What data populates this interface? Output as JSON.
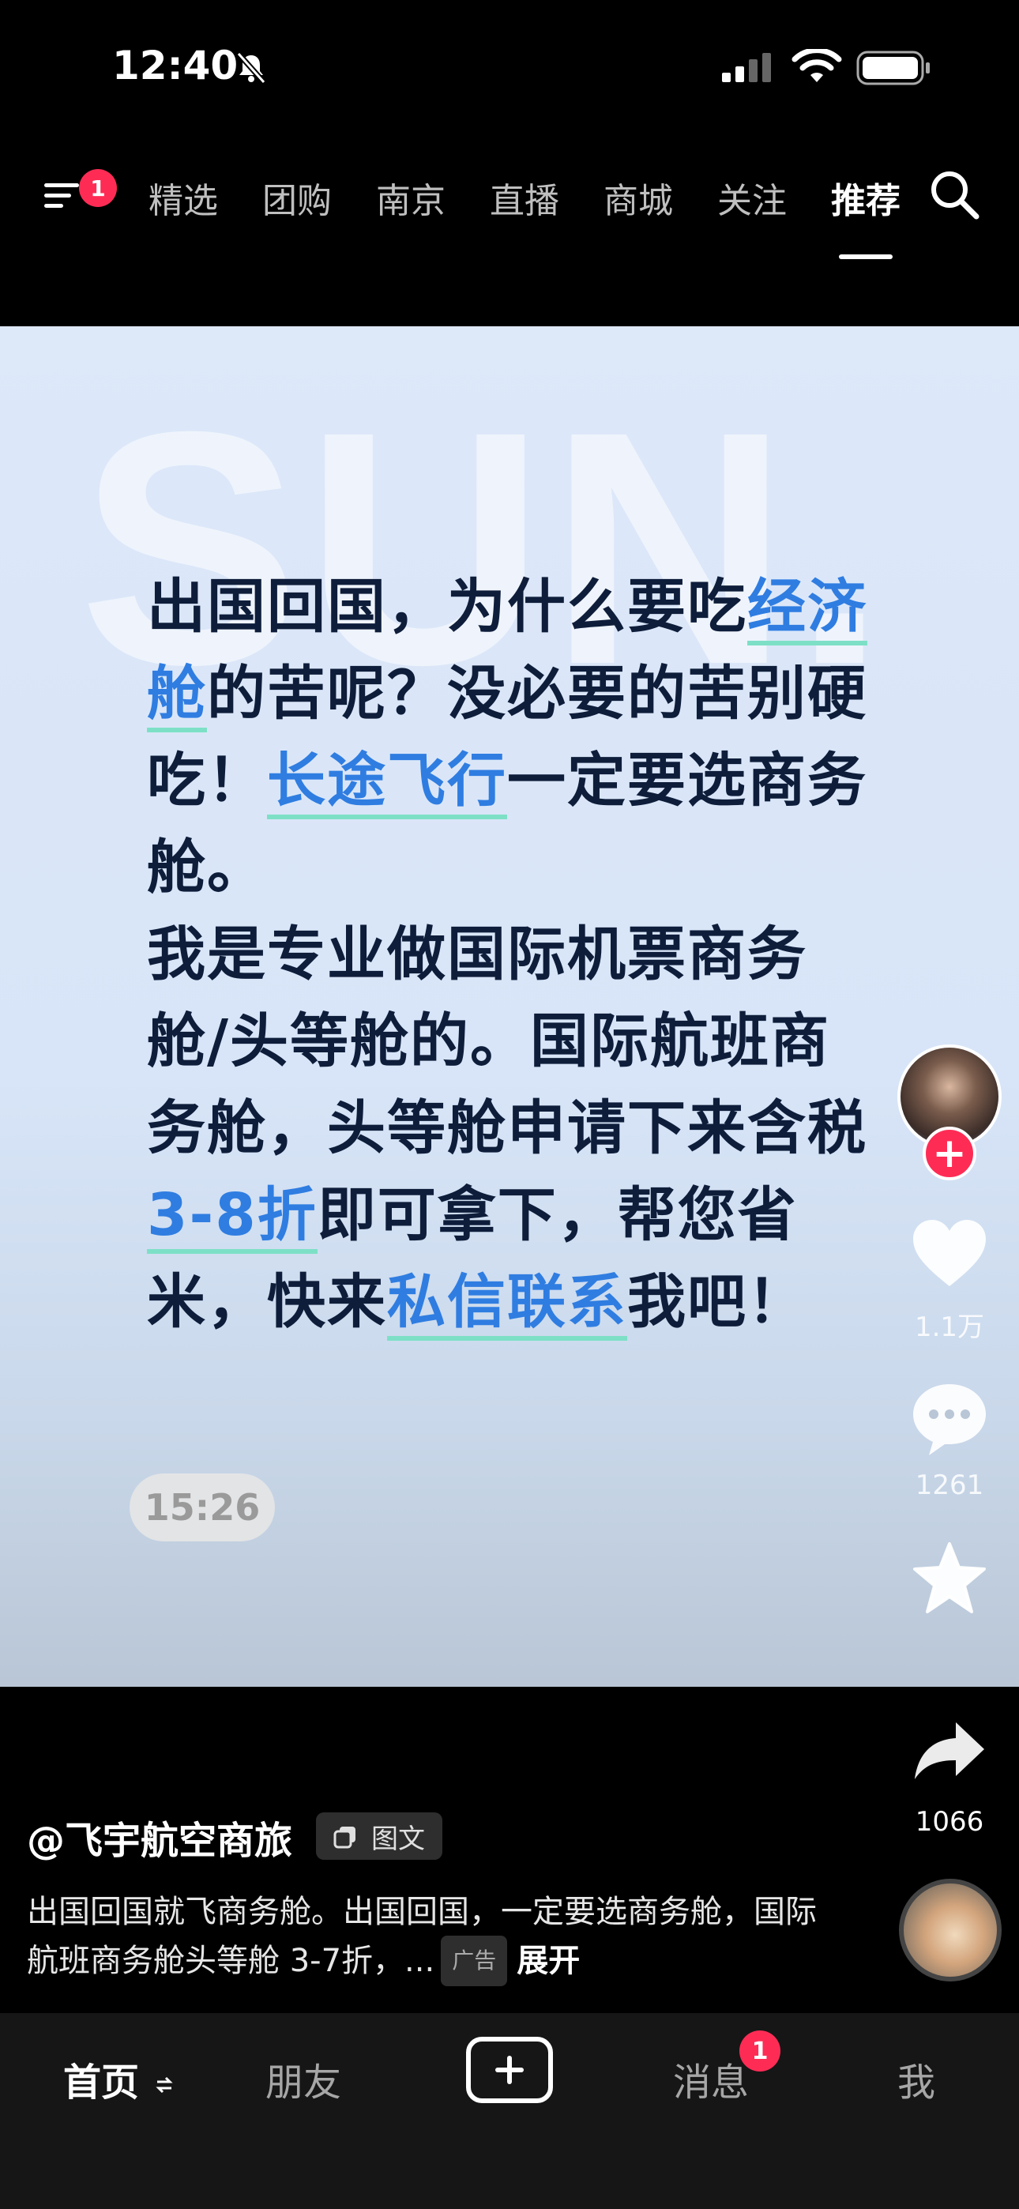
{
  "status_bar": {
    "time": "12:40",
    "icons": [
      "bell-muted-icon",
      "cellular-signal-icon",
      "wifi-icon",
      "battery-icon"
    ]
  },
  "top_nav": {
    "menu_badge": "1",
    "tabs": [
      {
        "label": "精选",
        "active": false
      },
      {
        "label": "团购",
        "active": false
      },
      {
        "label": "南京",
        "active": false
      },
      {
        "label": "直播",
        "active": false
      },
      {
        "label": "商城",
        "active": false
      },
      {
        "label": "关注",
        "active": false
      },
      {
        "label": "推荐",
        "active": true
      }
    ]
  },
  "card": {
    "watermark": "SUN.",
    "text_segments": [
      {
        "t": "出国回国，为什么要吃",
        "hl": false
      },
      {
        "t": "经济舱",
        "hl": true
      },
      {
        "t": "的苦呢？没必要的苦别硬吃！",
        "hl": false
      },
      {
        "t": "长途飞行",
        "hl": true
      },
      {
        "t": "一定要选商务舱。",
        "hl": false
      },
      {
        "t": "BR",
        "hl": false
      },
      {
        "t": "我是专业做国际机票商务舱/头等舱的。国际航班商务舱，头等舱申请下来含税",
        "hl": false
      },
      {
        "t": "3-8折",
        "hl": true
      },
      {
        "t": "即可拿下，帮您省米，快来",
        "hl": false
      },
      {
        "t": "私信联系",
        "hl": true
      },
      {
        "t": "我吧！",
        "hl": false
      }
    ],
    "time_chip": "15:26"
  },
  "rail": {
    "likes": "1.1万",
    "comments": "1261",
    "shares": "1066"
  },
  "caption": {
    "author": "@飞宇航空商旅",
    "tag": "图文",
    "description": "出国回国就飞商务舱。出国回国，一定要选商务舱，国际航班商务舱头等舱 3-7折，...",
    "ad_label": "广告",
    "expand": "展开"
  },
  "bottom_nav": {
    "home": "首页",
    "friends": "朋友",
    "messages": "消息",
    "messages_badge": "1",
    "me": "我"
  },
  "colors": {
    "accent": "#fe2c55",
    "highlight_text": "#2f7de1",
    "highlight_underline": "#7de0c6",
    "card_text": "#0e1d3a"
  }
}
